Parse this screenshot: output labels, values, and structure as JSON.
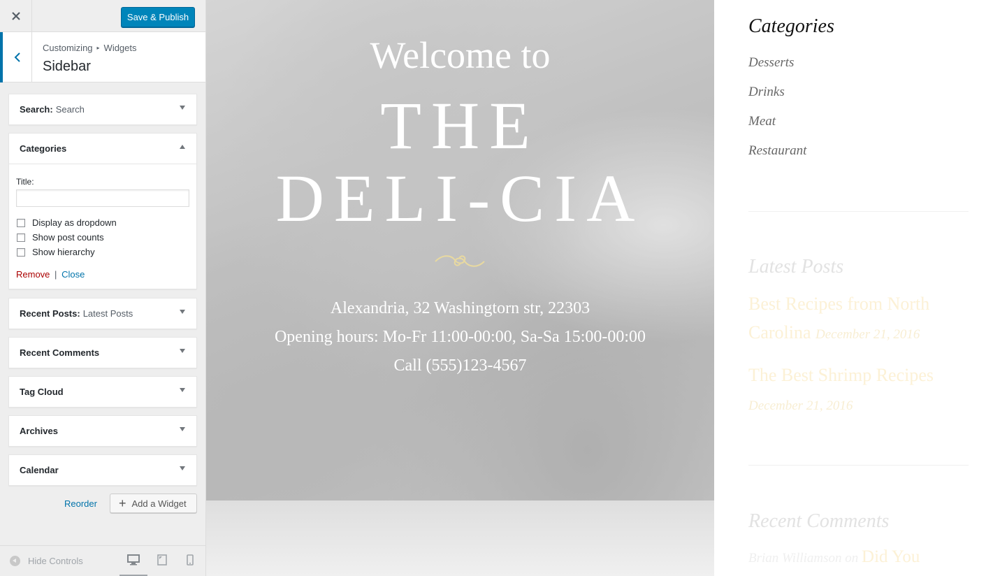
{
  "panel": {
    "save_label": "Save & Publish",
    "breadcrumb": {
      "parent": "Customizing",
      "current": "Widgets"
    },
    "title": "Sidebar",
    "widgets": [
      {
        "name": "Search:",
        "subtitle": "Search"
      },
      {
        "name": "Categories",
        "subtitle": ""
      },
      {
        "name": "Recent Posts:",
        "subtitle": "Latest Posts"
      },
      {
        "name": "Recent Comments",
        "subtitle": ""
      },
      {
        "name": "Tag Cloud",
        "subtitle": ""
      },
      {
        "name": "Archives",
        "subtitle": ""
      },
      {
        "name": "Calendar",
        "subtitle": ""
      }
    ],
    "categories_form": {
      "title_label": "Title:",
      "title_value": "",
      "options": [
        "Display as dropdown",
        "Show post counts",
        "Show hierarchy"
      ],
      "remove_label": "Remove",
      "separator": "|",
      "close_label": "Close"
    },
    "reorder_label": "Reorder",
    "add_widget_label": "Add a Widget",
    "hide_controls_label": "Hide Controls",
    "accent_color": "#0073aa",
    "save_color": "#0085ba"
  },
  "hero": {
    "welcome": "Welcome to",
    "title": "The Deli-cia",
    "address": "Alexandria, 32 Washingtorn str, 22303",
    "hours": "Opening hours: Mo-Fr 11:00-00:00, Sa-Sa 15:00-00:00",
    "phone": "Call (555)123-4567",
    "ornament_color": "#e8d9a0"
  },
  "sidebar_preview": {
    "categories_heading": "Categories",
    "categories": [
      "Desserts",
      "Drinks",
      "Meat",
      "Restaurant"
    ],
    "latest_heading": "Latest Posts",
    "posts": [
      {
        "title": "Best Recipes from North Carolina",
        "date": "December 21, 2016"
      },
      {
        "title": "The Best Shrimp Recipes",
        "date": "December 21, 2016"
      }
    ],
    "comments_heading": "Recent Comments",
    "comment": {
      "author": "Brian Williamson",
      "on": "on",
      "post": "Did You"
    }
  }
}
